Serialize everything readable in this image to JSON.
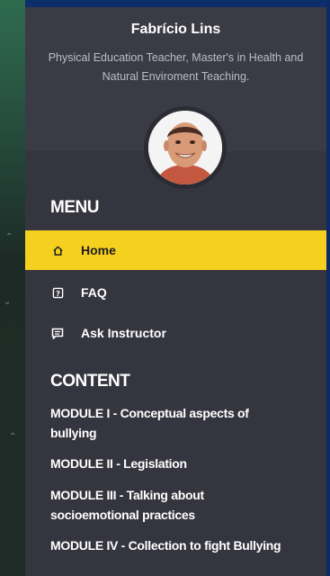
{
  "profile": {
    "name": "Fabrício Lins",
    "subtitle_line1": "Physical Education Teacher, Master's in Health and",
    "subtitle_line2": "Natural Enviroment Teaching."
  },
  "menu": {
    "heading": "MENU",
    "items": [
      {
        "label": "Home",
        "icon": "home-icon",
        "active": true
      },
      {
        "label": "FAQ",
        "icon": "question-icon",
        "active": false
      },
      {
        "label": "Ask Instructor",
        "icon": "chat-icon",
        "active": false
      }
    ]
  },
  "content": {
    "heading": "CONTENT",
    "modules": [
      {
        "line1": "MODULE I - Conceptual aspects of",
        "line2": "bullying"
      },
      {
        "line1": "MODULE II - Legislation",
        "line2": ""
      },
      {
        "line1": "MODULE III - Talking about",
        "line2": "socioemotional practices"
      },
      {
        "line1": "MODULE IV - Collection to fight Bullying",
        "line2": ""
      }
    ]
  },
  "colors": {
    "active_accent": "#f5d01f",
    "drawer_background": "#35353f",
    "header_background": "#3b3b46"
  }
}
